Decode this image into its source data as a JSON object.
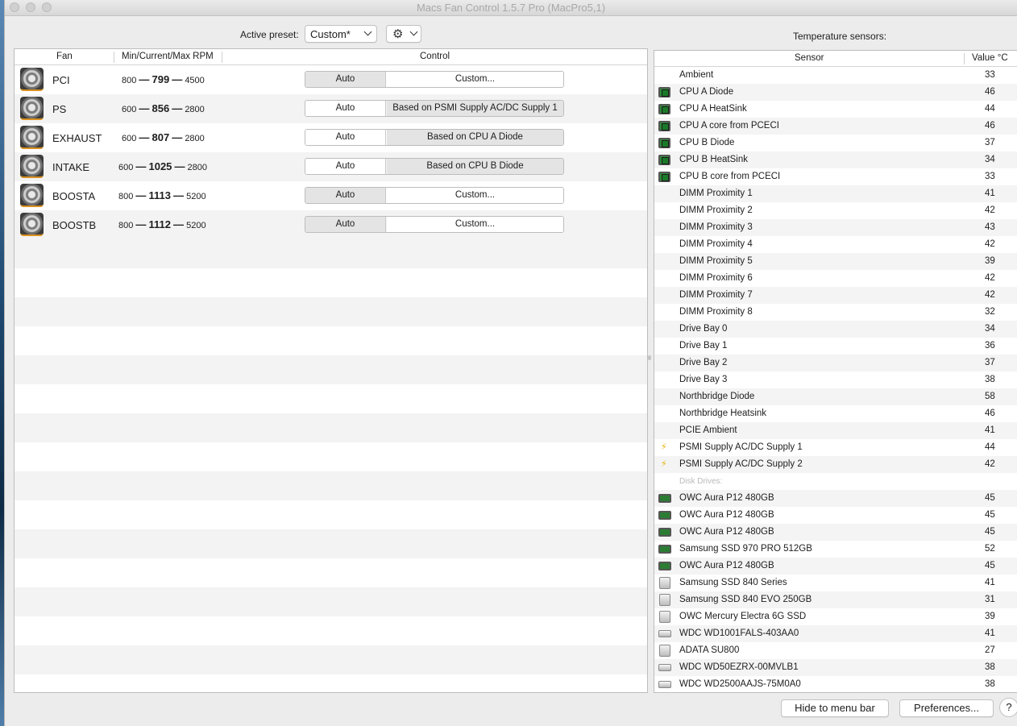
{
  "window": {
    "title": "Macs Fan Control 1.5.7 Pro (MacPro5,1)"
  },
  "toolbar": {
    "active_preset_label": "Active preset:",
    "preset_value": "Custom*",
    "gear_icon": "gear-icon"
  },
  "fans": {
    "headers": {
      "fan": "Fan",
      "rpm": "Min/Current/Max RPM",
      "control": "Control"
    },
    "auto_label": "Auto",
    "dash": "—",
    "rows": [
      {
        "name": "PCI",
        "min": "800",
        "current": "799",
        "max": "4500",
        "mode": "Custom...",
        "mode_selected": false
      },
      {
        "name": "PS",
        "min": "600",
        "current": "856",
        "max": "2800",
        "mode": "Based on PSMI Supply AC/DC Supply 1",
        "mode_selected": true
      },
      {
        "name": "EXHAUST",
        "min": "600",
        "current": "807",
        "max": "2800",
        "mode": "Based on CPU A Diode",
        "mode_selected": true
      },
      {
        "name": "INTAKE",
        "min": "600",
        "current": "1025",
        "max": "2800",
        "mode": "Based on CPU B Diode",
        "mode_selected": true
      },
      {
        "name": "BOOSTA",
        "min": "800",
        "current": "1113",
        "max": "5200",
        "mode": "Custom...",
        "mode_selected": false
      },
      {
        "name": "BOOSTB",
        "min": "800",
        "current": "1112",
        "max": "5200",
        "mode": "Custom...",
        "mode_selected": false
      }
    ]
  },
  "sensors": {
    "title": "Temperature sensors:",
    "headers": {
      "sensor": "Sensor",
      "value": "Value °C"
    },
    "rows": [
      {
        "name": "Ambient",
        "value": "33",
        "icon": ""
      },
      {
        "name": "CPU A Diode",
        "value": "46",
        "icon": "chip"
      },
      {
        "name": "CPU A HeatSink",
        "value": "44",
        "icon": "chip"
      },
      {
        "name": "CPU A core from PCECI",
        "value": "46",
        "icon": "chip"
      },
      {
        "name": "CPU B Diode",
        "value": "37",
        "icon": "chip"
      },
      {
        "name": "CPU B HeatSink",
        "value": "34",
        "icon": "chip"
      },
      {
        "name": "CPU B core from PCECI",
        "value": "33",
        "icon": "chip"
      },
      {
        "name": "DIMM Proximity 1",
        "value": "41",
        "icon": ""
      },
      {
        "name": "DIMM Proximity 2",
        "value": "42",
        "icon": ""
      },
      {
        "name": "DIMM Proximity 3",
        "value": "43",
        "icon": ""
      },
      {
        "name": "DIMM Proximity 4",
        "value": "42",
        "icon": ""
      },
      {
        "name": "DIMM Proximity 5",
        "value": "39",
        "icon": ""
      },
      {
        "name": "DIMM Proximity 6",
        "value": "42",
        "icon": ""
      },
      {
        "name": "DIMM Proximity 7",
        "value": "42",
        "icon": ""
      },
      {
        "name": "DIMM Proximity 8",
        "value": "32",
        "icon": ""
      },
      {
        "name": "Drive Bay 0",
        "value": "34",
        "icon": ""
      },
      {
        "name": "Drive Bay 1",
        "value": "36",
        "icon": ""
      },
      {
        "name": "Drive Bay 2",
        "value": "37",
        "icon": ""
      },
      {
        "name": "Drive Bay 3",
        "value": "38",
        "icon": ""
      },
      {
        "name": "Northbridge Diode",
        "value": "58",
        "icon": ""
      },
      {
        "name": "Northbridge Heatsink",
        "value": "46",
        "icon": ""
      },
      {
        "name": "PCIE Ambient",
        "value": "41",
        "icon": ""
      },
      {
        "name": "PSMI Supply AC/DC Supply 1",
        "value": "44",
        "icon": "bolt"
      },
      {
        "name": "PSMI Supply AC/DC Supply 2",
        "value": "42",
        "icon": "bolt"
      },
      {
        "name": "Disk Drives:",
        "value": "",
        "icon": "section"
      },
      {
        "name": "OWC Aura P12 480GB",
        "value": "45",
        "icon": "ssd"
      },
      {
        "name": "OWC Aura P12 480GB",
        "value": "45",
        "icon": "ssd"
      },
      {
        "name": "OWC Aura P12 480GB",
        "value": "45",
        "icon": "ssd"
      },
      {
        "name": "Samsung SSD 970 PRO 512GB",
        "value": "52",
        "icon": "ssd"
      },
      {
        "name": "OWC Aura P12 480GB",
        "value": "45",
        "icon": "ssd"
      },
      {
        "name": "Samsung SSD 840 Series",
        "value": "41",
        "icon": "hdd"
      },
      {
        "name": "Samsung SSD 840 EVO 250GB",
        "value": "31",
        "icon": "hdd"
      },
      {
        "name": "OWC Mercury Electra 6G SSD",
        "value": "39",
        "icon": "hdd"
      },
      {
        "name": "WDC WD1001FALS-403AA0",
        "value": "41",
        "icon": "hdd-flat"
      },
      {
        "name": "ADATA SU800",
        "value": "27",
        "icon": "hdd"
      },
      {
        "name": "WDC WD50EZRX-00MVLB1",
        "value": "38",
        "icon": "hdd-flat"
      },
      {
        "name": "WDC WD2500AAJS-75M0A0",
        "value": "38",
        "icon": "hdd-flat"
      }
    ]
  },
  "footer": {
    "hide_label": "Hide to menu bar",
    "prefs_label": "Preferences...",
    "help_label": "?"
  }
}
